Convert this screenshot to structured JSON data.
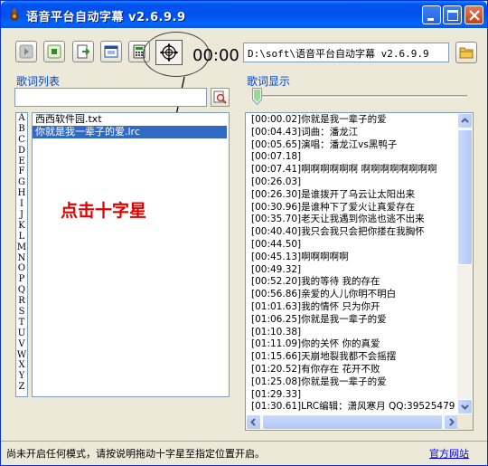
{
  "window": {
    "title": "语音平台自动字幕 v2.6.9.9"
  },
  "toolbar": {
    "timer": "00:00",
    "path_value": "D:\\soft\\语音平台自动字幕 v2.6.9.9"
  },
  "left_panel": {
    "label": "歌词列表",
    "search_value": "",
    "alphabet": [
      "A",
      "B",
      "C",
      "D",
      "E",
      "F",
      "G",
      "H",
      "I",
      "J",
      "K",
      "L",
      "M",
      "N",
      "O",
      "P",
      "Q",
      "R",
      "S",
      "T",
      "U",
      "V",
      "W",
      "X",
      "Y",
      "Z"
    ],
    "files": [
      {
        "name": "西西软件园.txt",
        "selected": false
      },
      {
        "name": "你就是我一辈子的爱.lrc",
        "selected": true
      }
    ]
  },
  "annotation": "点击十字星",
  "right_panel": {
    "label": "歌词显示",
    "lyrics": [
      "[00:00.02]你就是我一辈子的爱",
      "[00:04.43]词曲：潘龙江",
      "[00:05.65]演唱：潘龙江vs黑鸭子",
      "[00:07.18]",
      "[00:07.41]啊啊啊啊啊啊 啊啊啊啊啊啊啊啊",
      "[00:26.03]",
      "[00:26.30]是谁拨开了乌云让太阳出来",
      "[00:30.96]是谁种下了爱火让真爱存在",
      "[00:35.70]老天让我遇到你逃也逃不出来",
      "[00:40.40]我只会我只会把你搂在我胸怀",
      "[00:44.50]",
      "[00:45.13]啊啊啊啊啊",
      "[00:49.32]",
      "[00:52.20]我的等待 我的存在",
      "[00:56.86]亲爱的人儿你明不明白",
      "[01:01.63]我的情怀 只为你开",
      "[01:06.25]你就是我一辈子的爱",
      "[01:10.38]",
      "[01:11.09]你的关怀 你的真爱",
      "[01:15.66]天崩地裂我都不会摇摆",
      "[01:20.52]有你存在 花开不败",
      "[01:25.08]你就是我一辈子的爱",
      "[01:29.33]",
      "[01:30.61]LRC编辑：潇风寒月 QQ:39525479"
    ]
  },
  "status": {
    "text": "尚未开启任何模式，请按说明拖动十字星至指定位置开启。",
    "link": "官方网站"
  }
}
